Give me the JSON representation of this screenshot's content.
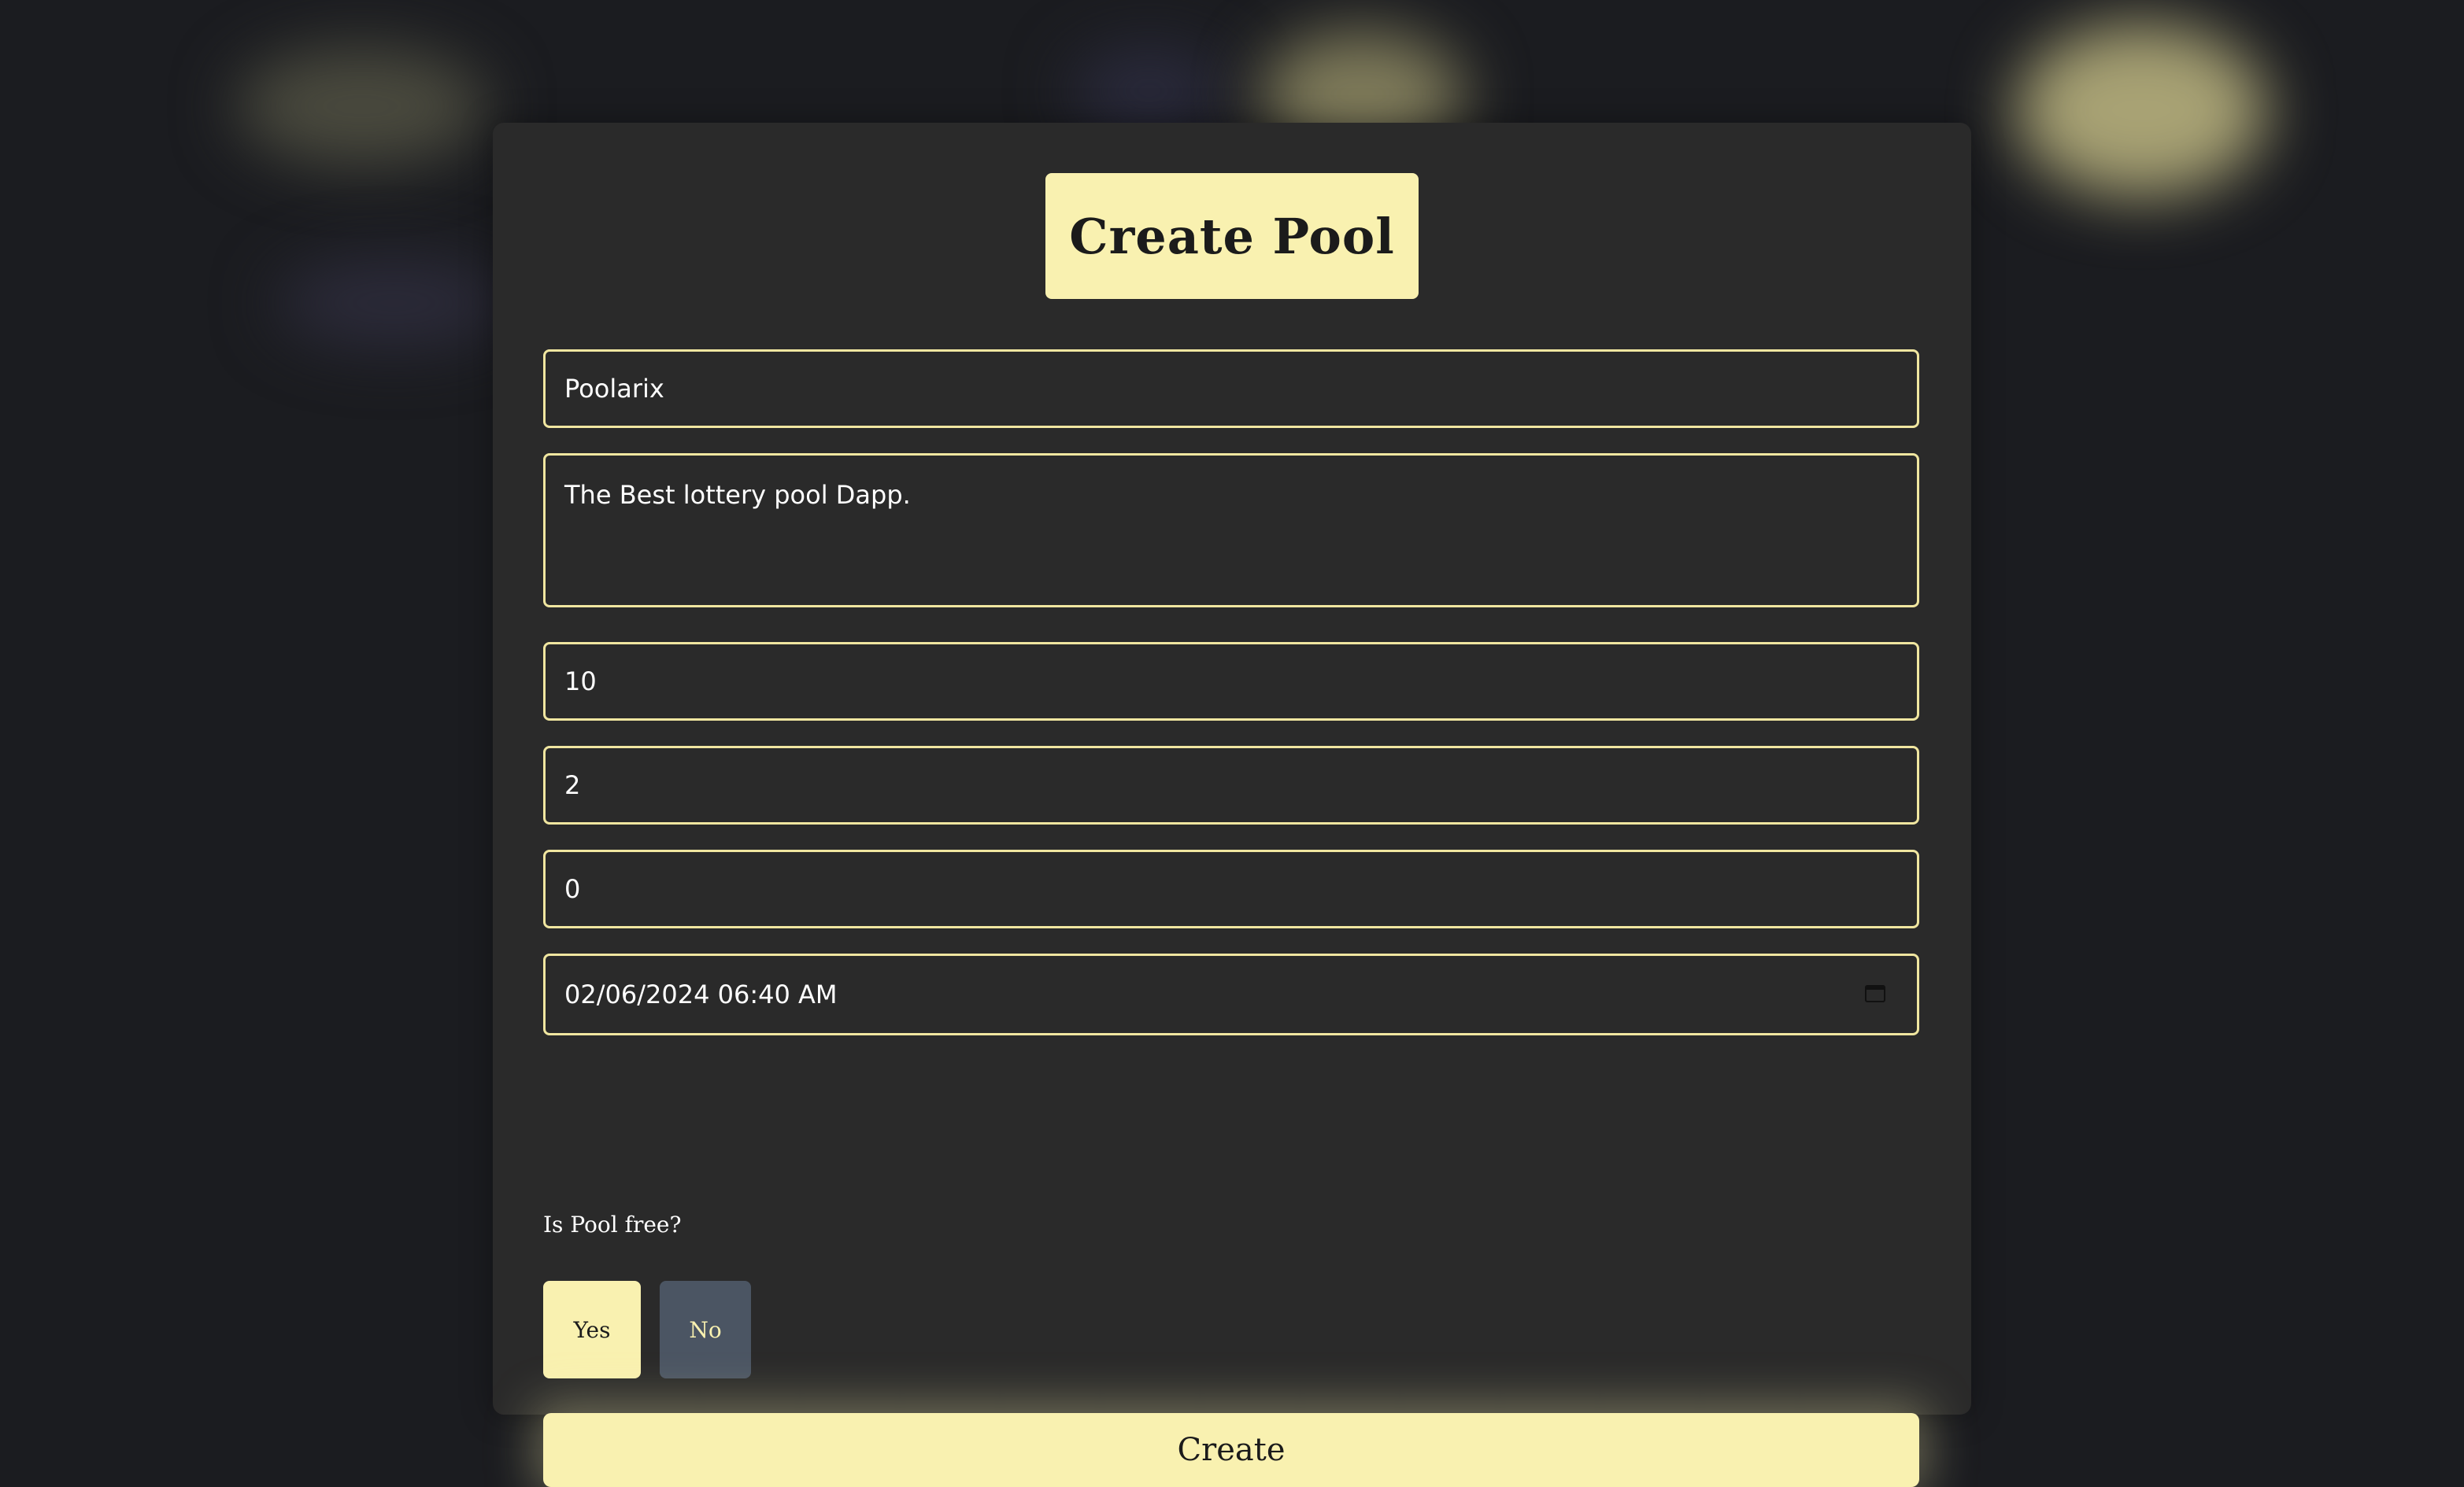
{
  "modal": {
    "title": "Create Pool"
  },
  "form": {
    "name_value": "Poolarix",
    "description_value": "The Best lottery pool Dapp.",
    "field3_value": "10",
    "field4_value": "2",
    "field5_value": "0",
    "datetime_value": "02/06/2024 06:40 AM",
    "free_label": "Is Pool free?",
    "yes_label": "Yes",
    "no_label": "No",
    "submit_label": "Create"
  },
  "colors": {
    "accent": "#f9f1b0",
    "background": "#1b1c20",
    "panel": "#2a2a2a",
    "no_button": "#4b5563"
  },
  "icons": {
    "datetime_picker": "calendar-icon"
  }
}
